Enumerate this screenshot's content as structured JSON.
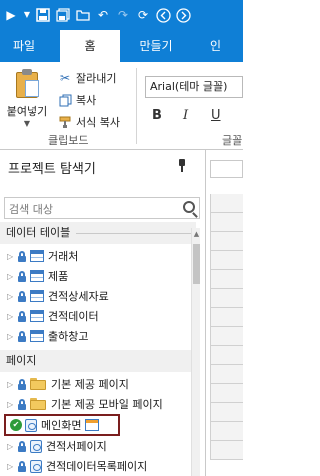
{
  "quick_access": {
    "icons": [
      "app-menu-icon",
      "dropdown-icon",
      "save-icon",
      "save-all-icon",
      "folder-icon",
      "undo-icon",
      "redo-icon",
      "refresh-icon",
      "back-icon",
      "forward-icon"
    ]
  },
  "ribbon": {
    "tabs": [
      {
        "label": "파일"
      },
      {
        "label": "홈",
        "active": true
      },
      {
        "label": "만들기"
      },
      {
        "label": "인"
      }
    ],
    "clipboard": {
      "paste_label": "붙여넣기",
      "cut_label": "잘라내기",
      "copy_label": "복사",
      "format_copy_label": "서식 복사",
      "group_label": "클립보드"
    },
    "font": {
      "font_name": "Arial(테마 글꼴)",
      "group_label": "글꼴",
      "bold": "B",
      "italic": "I",
      "underline": "U"
    }
  },
  "explorer": {
    "title": "프로젝트 탐색기",
    "search_placeholder": "검색 대상",
    "data_tables_header": "데이터 테이블",
    "tables": [
      {
        "label": "거래처"
      },
      {
        "label": "제품"
      },
      {
        "label": "견적상세자료"
      },
      {
        "label": "견적데이터"
      },
      {
        "label": "출하창고"
      }
    ],
    "pages_header": "페이지",
    "folders": [
      {
        "label": "기본 제공 페이지"
      },
      {
        "label": "기본 제공 모바일 페이지"
      }
    ],
    "pages": [
      {
        "label": "메인화면",
        "selected": true
      },
      {
        "label": "견적서페이지"
      },
      {
        "label": "견적데이터목록페이지"
      }
    ]
  },
  "colors": {
    "ribbon_blue": "#0f7fd6",
    "selection_border": "#7a1e1e",
    "icon_blue": "#3c7bc4"
  }
}
